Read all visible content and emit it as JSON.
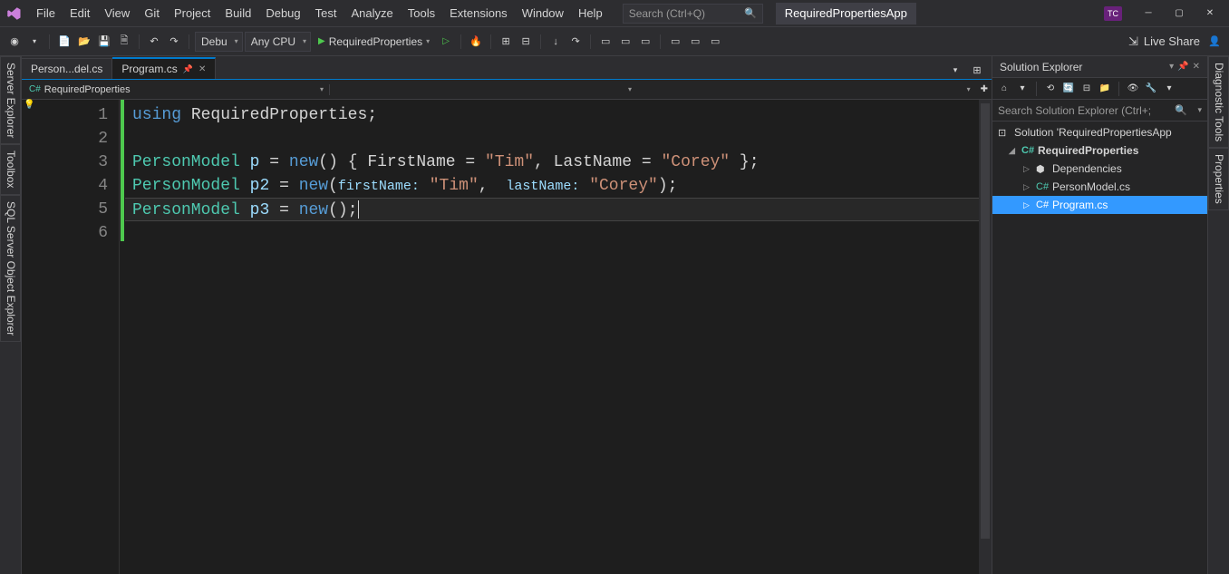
{
  "titlebar": {
    "menu": [
      "File",
      "Edit",
      "View",
      "Git",
      "Project",
      "Build",
      "Debug",
      "Test",
      "Analyze",
      "Tools",
      "Extensions",
      "Window",
      "Help"
    ],
    "search_placeholder": "Search (Ctrl+Q)",
    "app_name": "RequiredPropertiesApp",
    "user": "TC"
  },
  "toolbar": {
    "config": "Debu",
    "platform": "Any CPU",
    "start": "RequiredProperties",
    "live_share": "Live Share"
  },
  "left_tabs": [
    "Server Explorer",
    "Toolbox",
    "SQL Server Object Explorer"
  ],
  "right_tabs": [
    "Diagnostic Tools",
    "Properties"
  ],
  "doc_tabs": [
    {
      "label": "Person...del.cs",
      "active": false
    },
    {
      "label": "Program.cs",
      "active": true
    }
  ],
  "nav": {
    "project": "RequiredProperties",
    "scope": "",
    "member": ""
  },
  "code": {
    "lines": [
      1,
      2,
      3,
      4,
      5,
      6
    ]
  },
  "solution_explorer": {
    "title": "Solution Explorer",
    "search_placeholder": "Search Solution Explorer (Ctrl+;",
    "tree": {
      "solution": "Solution 'RequiredPropertiesApp",
      "project": "RequiredProperties",
      "deps": "Dependencies",
      "file1": "PersonModel.cs",
      "file2": "Program.cs"
    }
  }
}
